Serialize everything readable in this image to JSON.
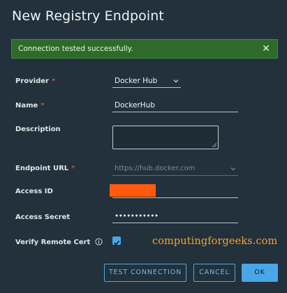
{
  "dialog": {
    "title": "New Registry Endpoint"
  },
  "alert": {
    "message": "Connection tested successfully.",
    "color": "#2e6b2a"
  },
  "form": {
    "provider": {
      "label": "Provider",
      "required_mark": "*",
      "value": "Docker Hub"
    },
    "name": {
      "label": "Name",
      "required_mark": "*",
      "value": "DockerHub"
    },
    "description": {
      "label": "Description",
      "value": ""
    },
    "endpoint_url": {
      "label": "Endpoint URL",
      "required_mark": "*",
      "value": "https://hub.docker.com"
    },
    "access_id": {
      "label": "Access ID",
      "value": ""
    },
    "access_secret": {
      "label": "Access Secret",
      "value": "•••••••••••"
    },
    "verify_remote_cert": {
      "label": "Verify Remote Cert",
      "checked": true
    }
  },
  "watermark": "computingforgeeks.com",
  "buttons": {
    "test_connection": "TEST CONNECTION",
    "cancel": "CANCEL",
    "ok": "OK"
  },
  "colors": {
    "accent": "#4aa6e6",
    "required": "#d8453c",
    "background": "#22313b"
  }
}
